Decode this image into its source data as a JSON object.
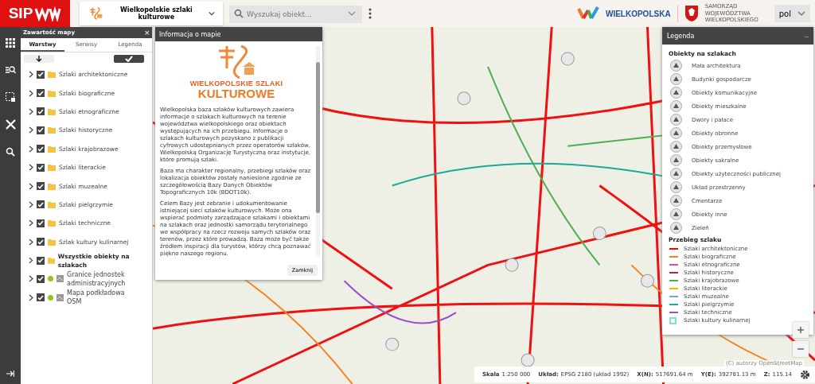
{
  "header": {
    "logo": "SIP",
    "app_title": "Wielkopolskie szlaki kulturowe",
    "search": {
      "placeholder": "Wyszukaj obiekt..."
    },
    "brand": "WIELKOPOLSKA",
    "authority": [
      "SAMORZĄD",
      "WOJEWÓDZTWA",
      "WIELKOPOLSKIEGO"
    ],
    "language": "pol"
  },
  "layers_panel": {
    "title": "Zawartość mapy",
    "close": "×",
    "tabs": [
      {
        "label": "Warstwy",
        "selected": true
      },
      {
        "label": "Serwisy",
        "selected": false
      },
      {
        "label": "Legenda",
        "selected": false
      }
    ],
    "items": [
      {
        "kind": "folder",
        "label": "Szlaki architektoniczne",
        "checked": true,
        "bold": false
      },
      {
        "kind": "folder",
        "label": "Szlaki biograficzne",
        "checked": true,
        "bold": false
      },
      {
        "kind": "folder",
        "label": "Szlaki etnograficzne",
        "checked": true,
        "bold": false
      },
      {
        "kind": "folder",
        "label": "Szlaki historyczne",
        "checked": true,
        "bold": false
      },
      {
        "kind": "folder",
        "label": "Szlaki krajobrazowe",
        "checked": true,
        "bold": false
      },
      {
        "kind": "folder",
        "label": "Szlaki literackie",
        "checked": true,
        "bold": false
      },
      {
        "kind": "folder",
        "label": "Szlaki muzealne",
        "checked": true,
        "bold": false
      },
      {
        "kind": "folder",
        "label": "Szlaki pielgrzymie",
        "checked": true,
        "bold": false
      },
      {
        "kind": "folder",
        "label": "Szlaki techniczne",
        "checked": true,
        "bold": false
      },
      {
        "kind": "folder",
        "label": "Szlak kultury kulinarnej",
        "checked": true,
        "bold": false
      },
      {
        "kind": "folder",
        "label": "Wszystkie obiekty na szlakach",
        "checked": true,
        "bold": true
      },
      {
        "kind": "service",
        "label": "Granice jednostek administracyjnych",
        "checked": true,
        "bold": false
      },
      {
        "kind": "service",
        "label": "Mapa podkładowa OSM",
        "checked": true,
        "bold": false
      }
    ]
  },
  "info_panel": {
    "title": "Informacja o mapie",
    "logo_lines": [
      "WIELKOPOLSKIE SZLAKI",
      "KULTUROWE"
    ],
    "paragraphs": [
      "Wielkopolska baza szlaków kulturowych zawiera informacje o szlakach kulturowych na terenie województwa wielkopolskiego oraz obiektach występujących na ich przebiegu. Informacje o szlakach kulturowych pozyskano z publikacji cyfrowych udostępnianych przez operatorów szlaków, Wielkopolską Organizację Turystyczną oraz instytucje, które promują szlaki.",
      "Baza ma charakter regionalny, przebiegi szlaków oraz lokalizacja obiektów zostały naniesione zgodnie ze szczegółowością Bazy Danych Obiektów Topograficznych 10k (BDOT10k).",
      "Celem Bazy jest zebranie i udokumentowanie istniejącej sieci szlaków kulturowych. Może ona wspierać podmioty zarządzające szlakami i obiektami na szlakach oraz jednostki samorządu terytorialnego we współpracy na rzecz rozwoju samych szlaków oraz terenów, przez które prowadzą. Baza może być także źródłem inspiracji dla turystów, którzy chcą poznawać piękno naszego regionu."
    ],
    "close_button": "Zamknij"
  },
  "legend": {
    "title": "Legenda",
    "collapse": "–",
    "objects_heading": "Obiekty na szlakach",
    "objects": [
      "Mała architektura",
      "Budynki gospodarcze",
      "Obiekty komunikacyjne",
      "Obiekty mieszkalne",
      "Dwory i pałace",
      "Obiekty obronne",
      "Obiekty przemysłowe",
      "Obiekty sakralne",
      "Obiekty użyteczności publicznej",
      "Układ przestrzenny",
      "Cmentarze",
      "Obiekty inne",
      "Zieleń"
    ],
    "routes_heading": "Przebieg szlaku",
    "routes": [
      {
        "kind": "line",
        "label": "Szlaki architektoniczne",
        "color": "#ff0000"
      },
      {
        "kind": "line",
        "label": "Szlaki biograficzne",
        "color": "#f58220"
      },
      {
        "kind": "line",
        "label": "Szlaki etnograficzne",
        "color": "#e8479a"
      },
      {
        "kind": "line",
        "label": "Szlaki historyczne",
        "color": "#a0275a"
      },
      {
        "kind": "line",
        "label": "Szlaki krajobrazowe",
        "color": "#4caf50"
      },
      {
        "kind": "line",
        "label": "Szlaki literackie",
        "color": "#ffb300"
      },
      {
        "kind": "line",
        "label": "Szlaki muzealne",
        "color": "#6fa8dc"
      },
      {
        "kind": "line",
        "label": "Szlaki pielgrzymie",
        "color": "#1aa89a"
      },
      {
        "kind": "line",
        "label": "Szlaki techniczne",
        "color": "#9c4dcc"
      },
      {
        "kind": "box",
        "label": "Szlaki kultury kulinarnej",
        "color": "#7fe3d0"
      }
    ]
  },
  "attribution": "(C) autorzy OpenStreetMap",
  "status_bar": [
    {
      "label": "Skala",
      "value": "1:250 000"
    },
    {
      "label": "Układ:",
      "value": "EPSG 2180 (układ 1992)"
    },
    {
      "label": "X(N):",
      "value": "517691.64 m"
    },
    {
      "label": "Y(E):",
      "value": "392781.13 m"
    },
    {
      "label": "Z:",
      "value": "115.14"
    }
  ]
}
